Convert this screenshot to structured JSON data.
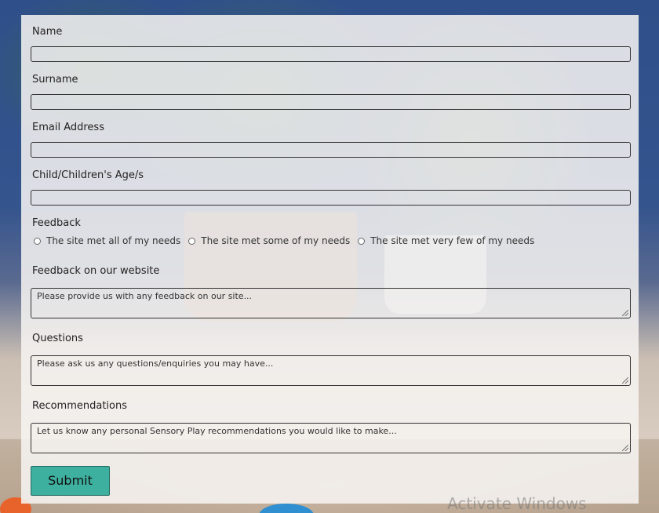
{
  "form": {
    "name_label": "Name",
    "surname_label": "Surname",
    "email_label": "Email Address",
    "age_label": "Child/Children's Age/s",
    "feedback_label": "Feedback",
    "feedback_options": [
      "The site met all of my needs",
      "The site met some of my needs",
      "The site met very few of my needs"
    ],
    "website_feedback_label": "Feedback on our website",
    "website_feedback_placeholder": "Please provide us with any feedback on our site...",
    "questions_label": "Questions",
    "questions_placeholder": "Please ask us any questions/enquiries you may have...",
    "recommendations_label": "Recommendations",
    "recommendations_placeholder": "Let us know any personal Sensory Play recommendations you would like to make...",
    "submit_label": "Submit"
  },
  "watermark": "Activate Windows",
  "colors": {
    "submit_bg": "#3eb0a0",
    "panel_bg": "#f7f5f2"
  }
}
